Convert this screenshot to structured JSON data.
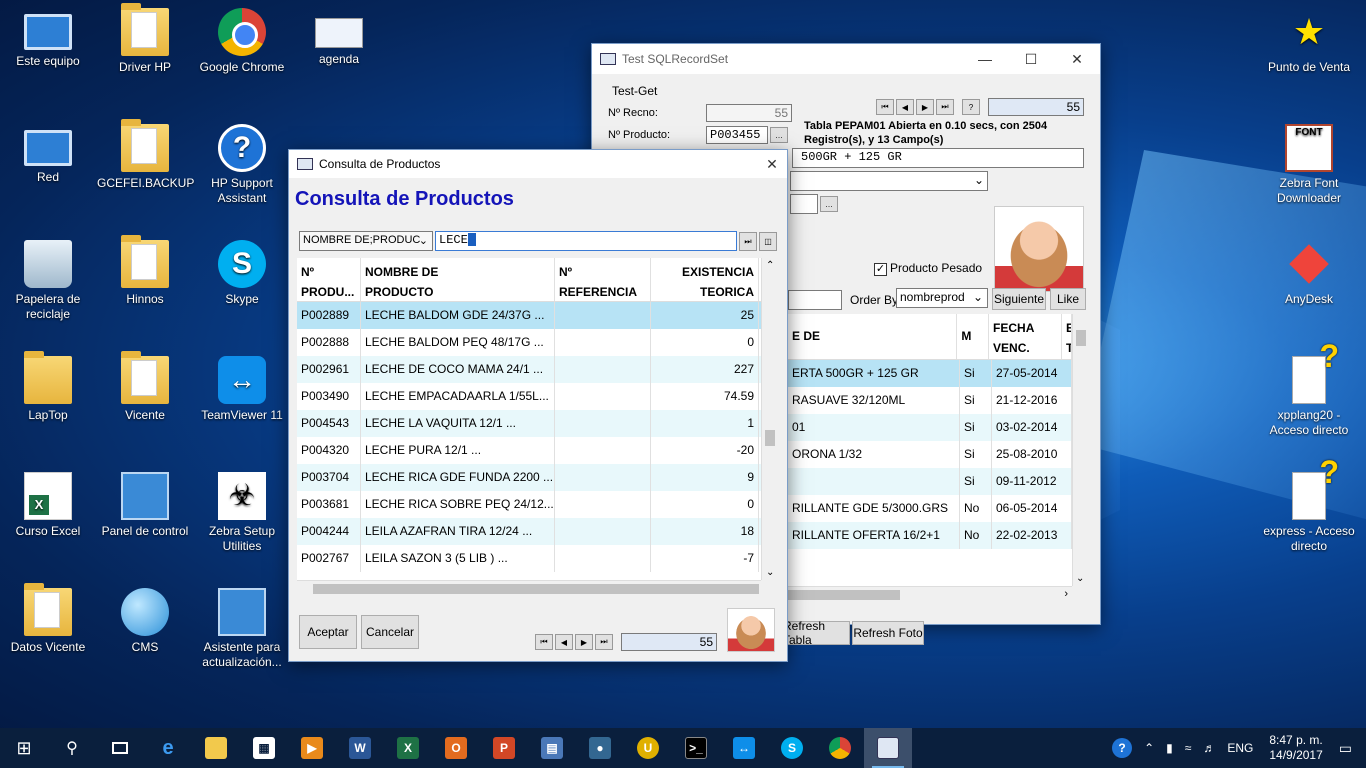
{
  "desktop": {
    "icons": [
      {
        "label": "Este equipo",
        "icon": "computer-icon"
      },
      {
        "label": "Driver HP",
        "icon": "folder-icon"
      },
      {
        "label": "Google Chrome",
        "icon": "chrome-icon"
      },
      {
        "label": "agenda",
        "icon": "document-icon"
      },
      {
        "label": "Red",
        "icon": "network-icon"
      },
      {
        "label": "GCEFEI.BACKUP",
        "icon": "folder-icon"
      },
      {
        "label": "HP Support Assistant",
        "icon": "help-icon"
      },
      {
        "label": "Papelera de reciclaje",
        "icon": "recycle-bin-icon"
      },
      {
        "label": "Hinnos",
        "icon": "folder-icon"
      },
      {
        "label": "Skype",
        "icon": "skype-icon"
      },
      {
        "label": "LapTop",
        "icon": "user-folder-icon"
      },
      {
        "label": "Vicente",
        "icon": "folder-icon"
      },
      {
        "label": "TeamViewer 11",
        "icon": "teamviewer-icon"
      },
      {
        "label": "Curso Excel",
        "icon": "excel-icon"
      },
      {
        "label": "Panel de control",
        "icon": "control-panel-icon"
      },
      {
        "label": "Zebra Setup Utilities",
        "icon": "zebra-icon"
      },
      {
        "label": "Datos Vicente",
        "icon": "folder-icon"
      },
      {
        "label": "CMS",
        "icon": "globe-icon"
      },
      {
        "label": "Asistente para actualización...",
        "icon": "update-icon"
      },
      {
        "label": "Punto de Venta",
        "icon": "chick-icon"
      },
      {
        "label": "Zebra Font Downloader",
        "icon": "font-icon"
      },
      {
        "label": "AnyDesk",
        "icon": "anydesk-icon"
      },
      {
        "label": "xpplang20 - Acceso directo",
        "icon": "question-doc-icon"
      },
      {
        "label": "express - Acceso directo",
        "icon": "question-doc-icon"
      }
    ]
  },
  "back_window": {
    "title": "Test SQLRecordSet",
    "group_label": "Test-Get",
    "recno_label": "Nº Recno:",
    "recno_value": "55",
    "producto_label": "Nº Producto:",
    "producto_value": "P003455",
    "nav_value": "55",
    "status_text": "Tabla PEPAM01 Abierta en 0.10 secs, con 2504 Registro(s), y 13 Campo(s)",
    "desc_value": "500GR + 125 GR",
    "pesado_label": "Producto Pesado",
    "order_by_label": "Order By:",
    "order_by_value": "nombreprod",
    "siguiente_label": "Siguiente",
    "like_label": "Like",
    "refresh_tabla_label": "Refresh Tabla",
    "refresh_foto_label": "Refresh Foto",
    "grid": {
      "headers": [
        "E DE",
        "M",
        "FECHA VENC.",
        "E T"
      ],
      "rows": [
        [
          "ERTA 500GR + 125 GR",
          "Si",
          "27-05-2014"
        ],
        [
          "RASUAVE 32/120ML",
          "Si",
          "21-12-2016"
        ],
        [
          "01",
          "Si",
          "03-02-2014"
        ],
        [
          "ORONA 1/32",
          "Si",
          "25-08-2010"
        ],
        [
          "",
          "Si",
          "09-11-2012"
        ],
        [
          "RILLANTE GDE 5/3000.GRS",
          "No",
          "06-05-2014"
        ],
        [
          "RILLANTE OFERTA 16/2+1",
          "No",
          "22-02-2013"
        ]
      ]
    }
  },
  "dialog": {
    "title": "Consulta de Productos",
    "heading": "Consulta de Productos",
    "search_field_select": "NOMBRE DE;PRODUC",
    "search_value": "LECE",
    "columns": [
      {
        "line1": "Nº",
        "line2": "PRODU..."
      },
      {
        "line1": "NOMBRE DE",
        "line2": "PRODUCTO"
      },
      {
        "line1": "Nº",
        "line2": "REFERENCIA"
      },
      {
        "line1": "EXISTENCIA",
        "line2": "TEORICA"
      }
    ],
    "rows": [
      [
        "P002889",
        "LECHE BALDOM GDE 24/37G       ...",
        "",
        "25"
      ],
      [
        "P002888",
        "LECHE BALDOM PEQ 48/17G        ...",
        "",
        "0"
      ],
      [
        "P002961",
        "LECHE DE COCO MAMA 24/1       ...",
        "",
        "227"
      ],
      [
        "P003490",
        "LECHE EMPACADAARLA 1/55L...",
        "",
        "74.59"
      ],
      [
        "P004543",
        "LECHE LA VAQUITA 12/1             ...",
        "",
        "1"
      ],
      [
        "P004320",
        "LECHE PURA 12/1                        ...",
        "",
        "-20"
      ],
      [
        "P003704",
        "LECHE RICA GDE FUNDA 2200 ...",
        "",
        "9"
      ],
      [
        "P003681",
        "LECHE RICA SOBRE PEQ 24/12...",
        "",
        "0"
      ],
      [
        "P004244",
        "LEILA AZAFRAN TIRA 12/24         ...",
        "",
        "18"
      ],
      [
        "P002767",
        "LEILA SAZON 3 (5 LIB )              ...",
        "",
        "-7"
      ]
    ],
    "aceptar_label": "Aceptar",
    "cancelar_label": "Cancelar",
    "nav_value": "55"
  },
  "taskbar": {
    "language": "ENG",
    "time": "8:47 p. m.",
    "date": "14/9/2017"
  },
  "colors": {
    "selected_row": "#b7e3f5",
    "alt_row": "#e8f8fb",
    "heading_blue": "#1414b8",
    "taskbar": "#0a1f3d"
  }
}
